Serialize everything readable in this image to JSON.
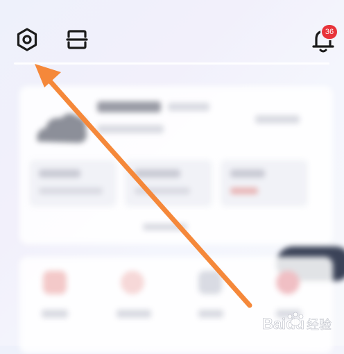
{
  "header": {
    "notification_count": "36",
    "icons": [
      "settings-hexagon-icon",
      "scan-icon",
      "bell-icon"
    ],
    "colors": {
      "icon": "#1b1b1b",
      "badge": "#e8333a"
    }
  },
  "annotation": {
    "arrow_color": "#f5883a"
  },
  "watermark": {
    "brand": "Baidu",
    "tagline": "经验"
  }
}
